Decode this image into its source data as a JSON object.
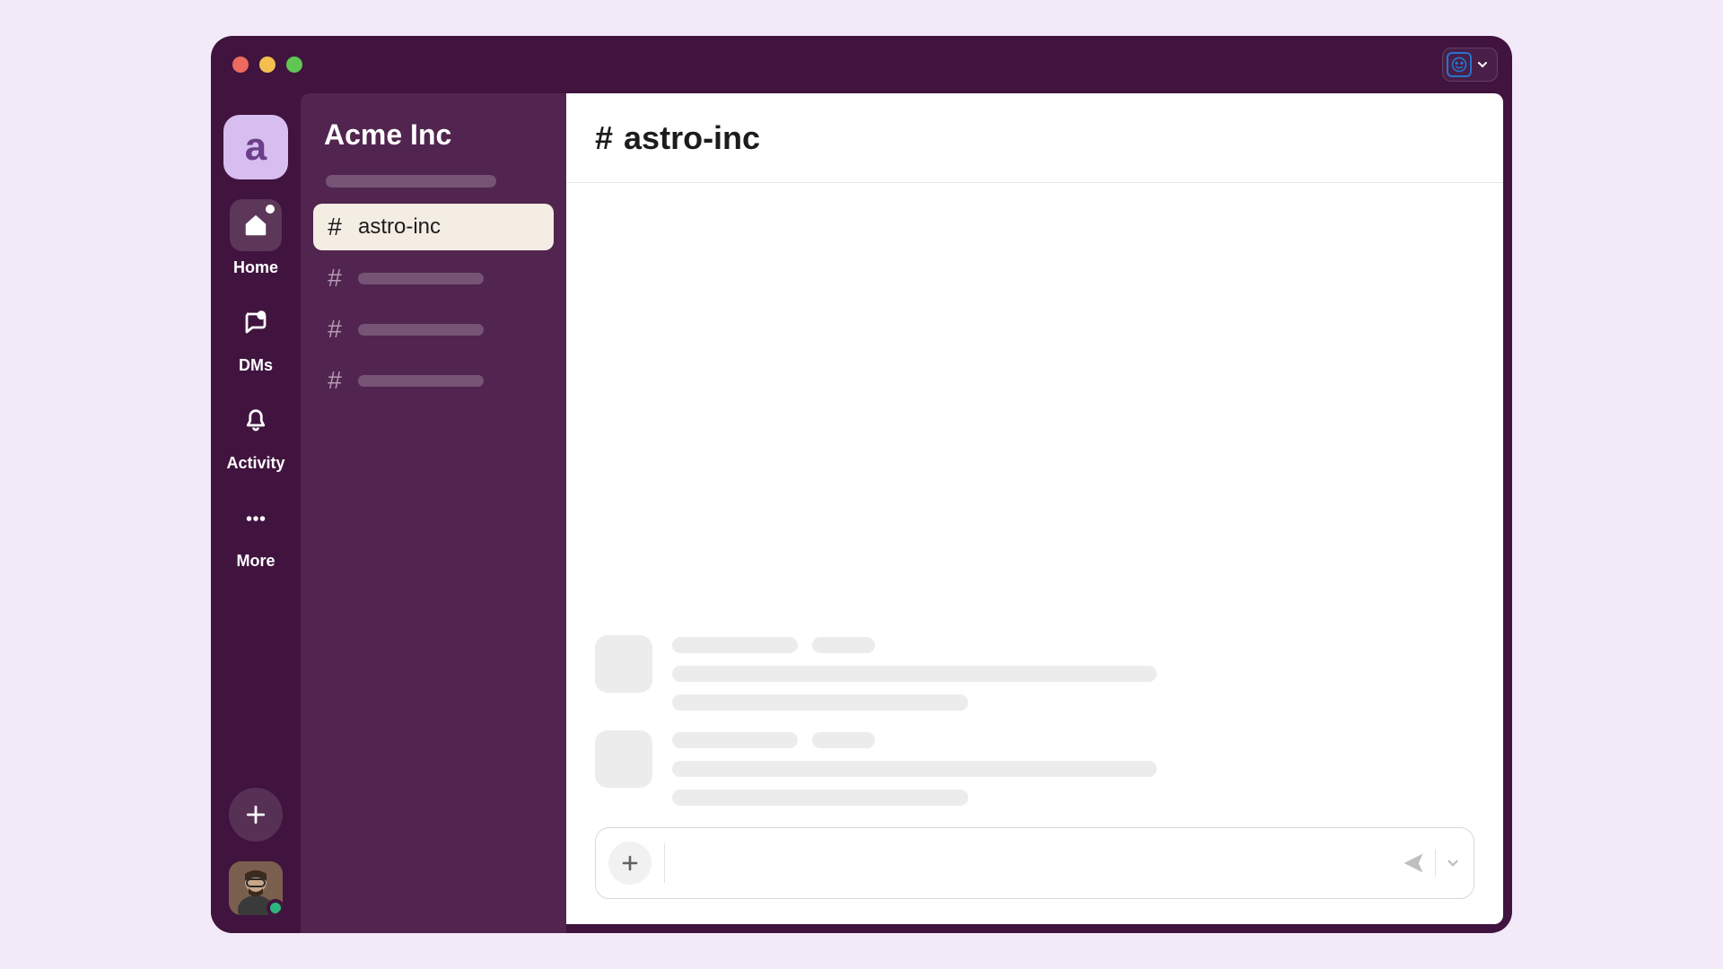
{
  "workspace": {
    "letter": "a",
    "name": "Acme Inc"
  },
  "rail": {
    "home": "Home",
    "dms": "DMs",
    "activity": "Activity",
    "more": "More"
  },
  "channels": {
    "active": "astro-inc"
  },
  "header": {
    "hash": "#",
    "title": "astro-inc"
  },
  "composer": {
    "placeholder": ""
  }
}
